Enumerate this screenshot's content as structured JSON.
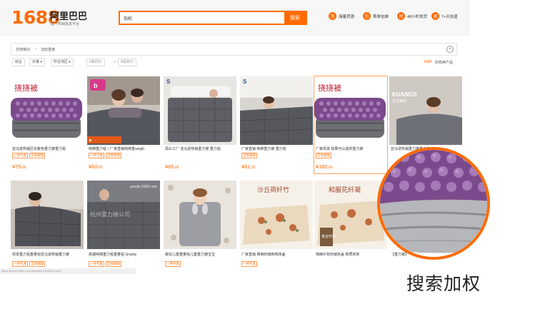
{
  "header": {
    "logo_number": "1688",
    "logo_name": "阿里巴巴",
    "logo_sub": "旗下热销批发平台",
    "search_value": "加权",
    "search_button": "搜索",
    "services": [
      {
        "icon": "truck-icon",
        "glyph": "货",
        "label": "海量货源"
      },
      {
        "icon": "shipping-icon",
        "glyph": "包",
        "label": "首单包邮"
      },
      {
        "icon": "clock-icon",
        "glyph": "时",
        "label": "48小时发货"
      },
      {
        "icon": "return-icon",
        "glyph": "退",
        "label": "7+天包退"
      }
    ]
  },
  "breadcrumb": {
    "label": "您搜索的:",
    "term": "加权重被"
  },
  "filters": {
    "sort_default": "综合",
    "sort_price": "价格",
    "sort_area": "所在地区",
    "price_from_placeholder": "¥最低价",
    "price_to_placeholder": "¥最高价",
    "promo_tag": "1688",
    "promo_text": "的热卖产品"
  },
  "products_row1": [
    {
      "title": "亚马逊热销压花紫色重力被重力毯",
      "tags": [
        "一件代发",
        "交易保障"
      ],
      "price_symbol": "¥",
      "price": "75",
      "price_dec": ".00"
    },
    {
      "title": "纯棉重力毯丨厂家直销纯棉重weigh",
      "tags": [
        "一件代发",
        "交易保障"
      ],
      "price_symbol": "¥",
      "price": "60",
      "price_dec": ".00"
    },
    {
      "title": "源头工厂 亚马逊热销重力被 重力毯",
      "tags": [],
      "price_symbol": "¥",
      "price": "85",
      "price_dec": ".00"
    },
    {
      "title": "厂家直销 纯棉重力被 重力毯",
      "tags": [
        "交易保障"
      ],
      "price_symbol": "¥",
      "price": "81",
      "price_dec": ".00"
    },
    {
      "title": "厂家现货 如果可以退的重力被",
      "tags": [
        "交易保障"
      ],
      "price_symbol": "¥",
      "price": "180",
      "price_dec": ".00"
    },
    {
      "title": "亚马逊热销重力被重力毯",
      "tags": [],
      "price_symbol": "",
      "price": "",
      "price_dec": ""
    }
  ],
  "products_row2": [
    {
      "title": "现货重力毯重量毯亚马逊热销重力被",
      "tags": [
        "一件代发",
        "交易保障"
      ]
    },
    {
      "title": "高端纯棉重力毯重量毯 Gravity",
      "tags": [
        "一件代发",
        "交易保障"
      ]
    },
    {
      "title": "婴幼儿童重量毯儿童重力被宝宝",
      "tags": [
        "一件代发"
      ]
    },
    {
      "title": "厂家直销 棉麻绗缝刺绣床盖",
      "tags": [
        "一件代发"
      ]
    },
    {
      "title": "棉麻印花绗缝床盖 棉质床单",
      "tags": []
    },
    {
      "title": "【重力被】",
      "tags": []
    }
  ],
  "card_prints": {
    "brand_chinese": "挠挠被",
    "seller_watermark": "杭州重力被公司",
    "site_watermark": "gravity.1688.com",
    "quilt_brand_1": "沙丘荷纤竹",
    "quilt_brand_2": "和服花纤凝",
    "quilt_brand_3": "真丝竹纤",
    "logo_kuangs": "KUANGS",
    "logo_kuangs_sub": "匡氏家纺"
  },
  "status_url": "https://detail.1688.com/offer/5847264092b.html",
  "caption": "搜索加权",
  "colors": {
    "accent": "#ff6a00",
    "purple": "#7b4a8c",
    "gray": "#6d6f74"
  }
}
